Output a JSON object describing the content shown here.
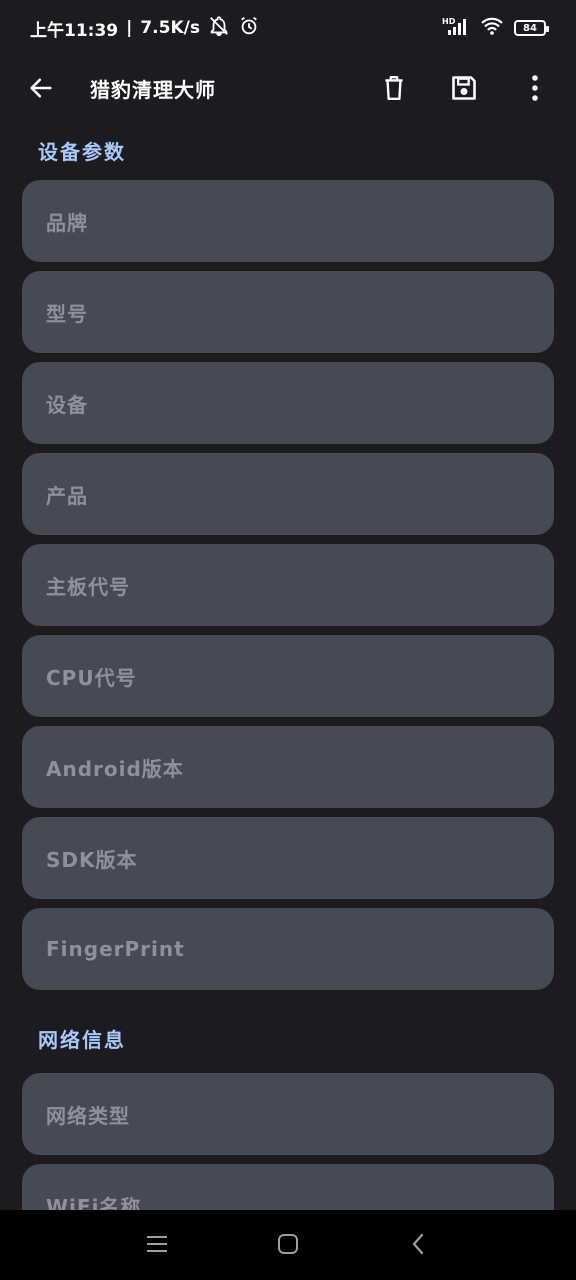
{
  "status_bar": {
    "time": "上午11:39",
    "separator": "|",
    "net_speed": "7.5K/s",
    "battery_level": "84",
    "icons": [
      "notifications-off-icon",
      "alarm-icon",
      "hd-signal-icon",
      "wifi-icon",
      "battery-icon"
    ]
  },
  "toolbar": {
    "title": "猎豹清理大师",
    "icons": [
      "back-arrow-icon",
      "delete-icon",
      "save-icon",
      "more-vert-icon"
    ]
  },
  "sections": [
    {
      "title": "设备参数",
      "fields": [
        "品牌",
        "型号",
        "设备",
        "产品",
        "主板代号",
        "CPU代号",
        "Android版本",
        "SDK版本",
        "FingerPrint"
      ]
    },
    {
      "title": "网络信息",
      "fields": [
        "网络类型",
        "WiFi名称"
      ]
    }
  ],
  "colors": {
    "background": "#1c1b1f",
    "field_background": "#464a55",
    "section_title": "#a8c7fa",
    "placeholder_text": "#8e919b"
  },
  "nav_bar": {
    "icons": [
      "menu-icon",
      "home-icon",
      "back-icon"
    ]
  }
}
